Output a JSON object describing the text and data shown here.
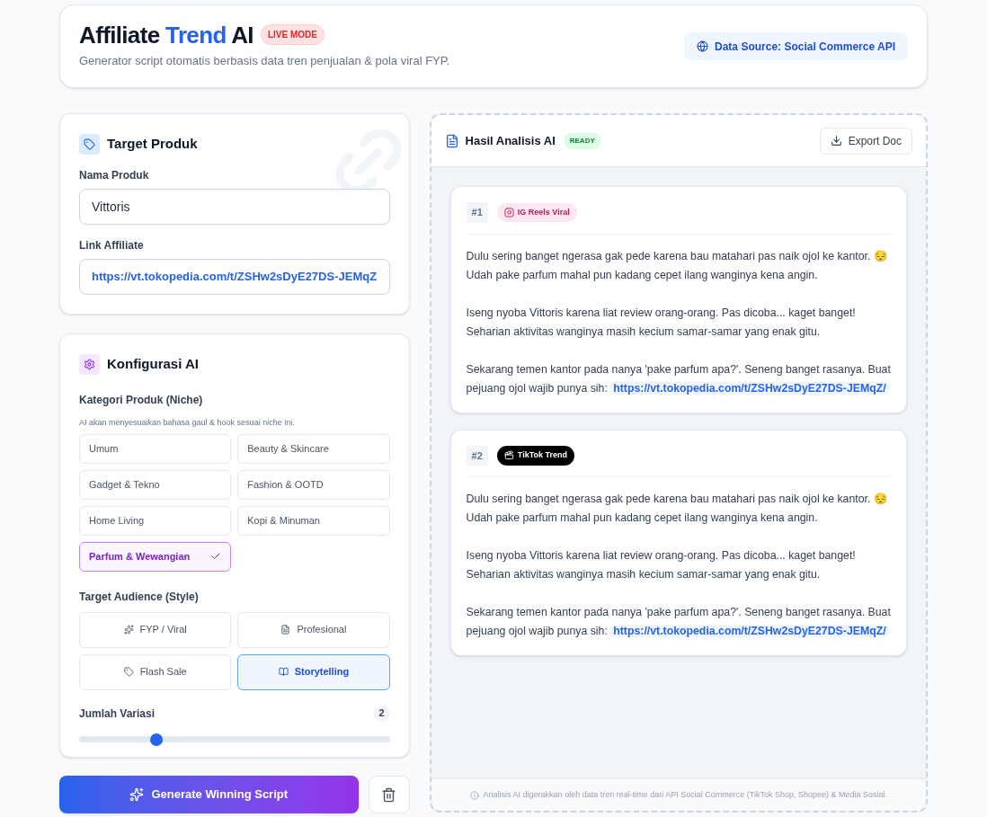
{
  "header": {
    "title_parts": [
      {
        "text": "Affiliate ",
        "accent": false
      },
      {
        "text": "Trend",
        "accent": true
      },
      {
        "text": " AI",
        "accent": false
      }
    ],
    "badge": "LIVE MODE",
    "subtitle": "Generator script otomatis berbasis data tren penjualan & pola viral FYP.",
    "source_button": "Data Source: Social Commerce API"
  },
  "target_card": {
    "title": "Target Produk",
    "fields": [
      {
        "label": "Nama Produk",
        "value": "Vittoris",
        "kind": "text"
      },
      {
        "label": "Link Affiliate",
        "value": "https://vt.tokopedia.com/t/ZSHw2sDyE27DS-JEMqZ",
        "kind": "link"
      }
    ]
  },
  "config_card": {
    "title": "Konfigurasi AI",
    "category_label": "Kategori Produk (Niche)",
    "category_hint": "AI akan menyesuaikan bahasa gaul & hook sesuai niche ini.",
    "categories": [
      {
        "label": "Umum",
        "selected": false
      },
      {
        "label": "Beauty & Skincare",
        "selected": false
      },
      {
        "label": "Gadget & Tekno",
        "selected": false
      },
      {
        "label": "Fashion & OOTD",
        "selected": false
      },
      {
        "label": "Home Living",
        "selected": false
      },
      {
        "label": "Kopi & Minuman",
        "selected": false
      },
      {
        "label": "Parfum & Wewangian",
        "selected": true
      }
    ],
    "audience_label": "Target Audience (Style)",
    "audiences": [
      {
        "label": "FYP / Viral",
        "selected": false
      },
      {
        "label": "Profesional",
        "selected": false
      },
      {
        "label": "Flash Sale",
        "selected": false
      },
      {
        "label": "Storytelling",
        "selected": true
      }
    ],
    "variation": {
      "label": "Jumlah Variasi",
      "value": "2",
      "level": 0.25
    }
  },
  "generate_button": "Generate Winning Script",
  "results": {
    "title": "Hasil Analisis AI",
    "status": "READY",
    "export_button": "Export Doc",
    "scripts": [
      {
        "number": "#1",
        "tag": "IG Reels Viral",
        "kind": "instagram",
        "paragraphs": [
          "Dulu sering banget ngerasa gak pede karena bau matahari pas naik ojol ke kantor. 😔 Udah pake parfum mahal pun kadang cepet ilang wanginya kena angin.",
          "Iseng nyoba Vittoris karena liat review orang-orang. Pas dicoba... kaget banget! Seharian aktivitas wanginya masih kecium samar-samar yang enak gitu."
        ],
        "closing": "Sekarang temen kantor pada nanya 'pake parfum apa?'. Seneng banget rasanya. Buat pejuang ojol wajib punya sih:",
        "link": "https://vt.tokopedia.com/t/ZSHw2sDyE27DS-JEMqZ/"
      },
      {
        "number": "#2",
        "tag": "TikTok Trend",
        "kind": "tiktok",
        "paragraphs": [
          "Dulu sering banget ngerasa gak pede karena bau matahari pas naik ojol ke kantor. 😔 Udah pake parfum mahal pun kadang cepet ilang wanginya kena angin.",
          "Iseng nyoba Vittoris karena liat review orang-orang. Pas dicoba... kaget banget! Seharian aktivitas wanginya masih kecium samar-samar yang enak gitu."
        ],
        "closing": "Sekarang temen kantor pada nanya 'pake parfum apa?'. Seneng banget rasanya. Buat pejuang ojol wajib punya sih:",
        "link": "https://vt.tokopedia.com/t/ZSHw2sDyE27DS-JEMqZ/"
      }
    ],
    "footer": "Analisis AI digerakkan oleh data tren real-time dari API Social Commerce (TikTok Shop, Shopee) & Media Sosial."
  }
}
